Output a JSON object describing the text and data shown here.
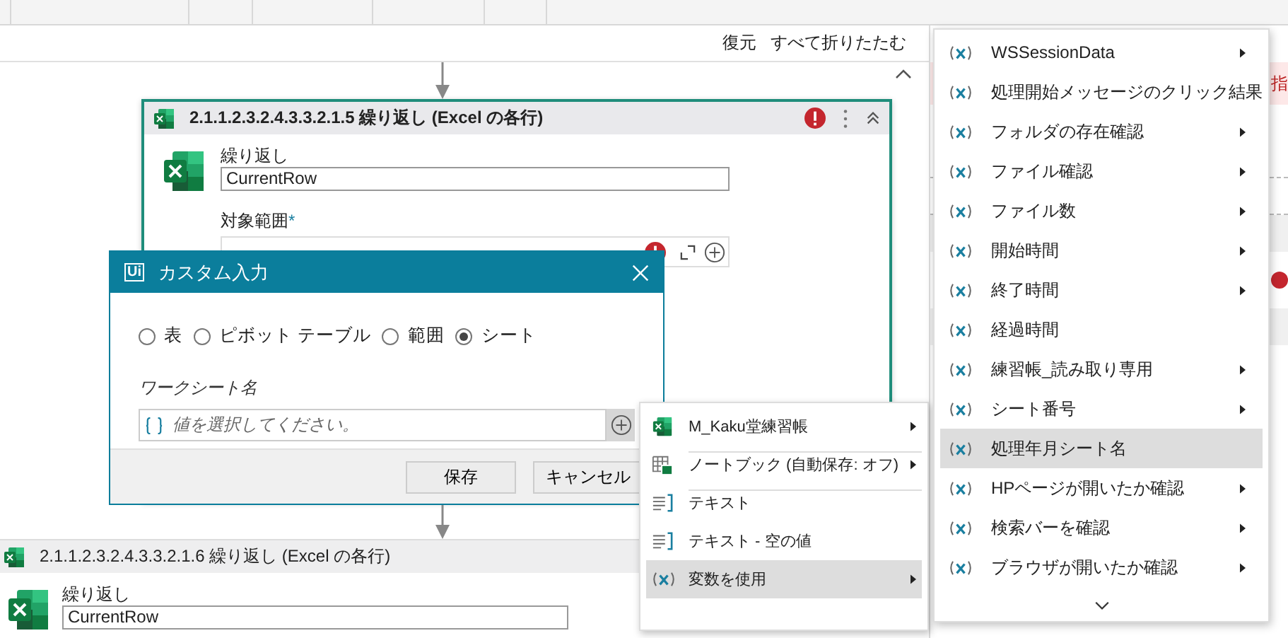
{
  "toolbar": {
    "buttons": [
      "復元",
      "すべて折りたたむ"
    ]
  },
  "activities": [
    {
      "title": "2.1.1.2.3.2.4.3.3.2.1.5 繰り返し (Excel の各行)",
      "selected": true,
      "error": true,
      "fields": [
        {
          "label": "繰り返し",
          "value": "CurrentRow"
        },
        {
          "label": "対象範囲",
          "required_mark": "*",
          "error": true
        }
      ]
    },
    {
      "title": "2.1.1.2.3.2.4.3.3.2.1.6 繰り返し (Excel の各行)",
      "selected": false,
      "fields": [
        {
          "label": "繰り返し",
          "value": "CurrentRow"
        }
      ]
    }
  ],
  "side_panel": {
    "error_text": "指"
  },
  "dialog": {
    "logo": "Ui",
    "title": "カスタム入力",
    "options": [
      {
        "label": "表",
        "selected": false
      },
      {
        "label": "ピボット テーブル",
        "selected": false
      },
      {
        "label": "範囲",
        "selected": false
      },
      {
        "label": "シート",
        "selected": true
      }
    ],
    "field": {
      "label": "ワークシート名",
      "placeholder": "値を選択してください。"
    },
    "buttons": [
      "保存",
      "キャンセル"
    ]
  },
  "context_menu": {
    "items": [
      {
        "kind": "workbook",
        "label": "M_Kaku堂練習帳",
        "submenu": true,
        "selected": false
      },
      {
        "kind": "notebook",
        "label": "ノートブック (自動保存: オフ)",
        "submenu": true,
        "selected": false,
        "separator_before": true
      },
      {
        "kind": "text",
        "label": "テキスト",
        "submenu": false,
        "selected": false,
        "separator_before": true
      },
      {
        "kind": "text",
        "label": "テキスト - 空の値",
        "submenu": false,
        "selected": false
      },
      {
        "kind": "variable",
        "label": "変数を使用",
        "submenu": true,
        "selected": true
      }
    ]
  },
  "variables_menu": {
    "items": [
      {
        "label": "WSSessionData",
        "submenu": true,
        "selected": false
      },
      {
        "label": "処理開始メッセージのクリック結果",
        "submenu": false,
        "selected": false
      },
      {
        "label": "フォルダの存在確認",
        "submenu": true,
        "selected": false
      },
      {
        "label": "ファイル確認",
        "submenu": true,
        "selected": false
      },
      {
        "label": "ファイル数",
        "submenu": true,
        "selected": false
      },
      {
        "label": "開始時間",
        "submenu": true,
        "selected": false
      },
      {
        "label": "終了時間",
        "submenu": true,
        "selected": false
      },
      {
        "label": "経過時間",
        "submenu": false,
        "selected": false
      },
      {
        "label": "練習帳_読み取り専用",
        "submenu": true,
        "selected": false
      },
      {
        "label": "シート番号",
        "submenu": true,
        "selected": false
      },
      {
        "label": "処理年月シート名",
        "submenu": false,
        "selected": true
      },
      {
        "label": "HPページが開いたか確認",
        "submenu": true,
        "selected": false
      },
      {
        "label": "検索バーを確認",
        "submenu": true,
        "selected": false
      },
      {
        "label": "ブラウザが開いたか確認",
        "submenu": true,
        "selected": false
      }
    ],
    "more_below": true
  }
}
